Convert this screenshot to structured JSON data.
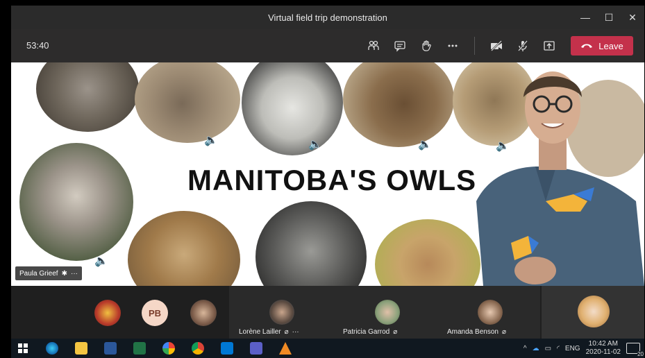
{
  "window": {
    "title": "Virtual field trip demonstration",
    "controls": [
      "—",
      "☐",
      "✕"
    ]
  },
  "toolbar": {
    "timer": "53:40",
    "leave_label": "Leave"
  },
  "slide": {
    "title": "MANITOBA'S OWLS"
  },
  "presenter": {
    "name": "Paula Grieef"
  },
  "participants": [
    {
      "initials": "PB"
    },
    {
      "name": "Lorène Lailler"
    },
    {
      "name": "Patricia Garrod"
    },
    {
      "name": "Amanda Benson"
    }
  ],
  "taskbar": {
    "language": "ENG",
    "time": "10:42 AM",
    "date": "2020-11-02",
    "notifications": "20"
  },
  "colors": {
    "leave": "#c4314b",
    "toolbar": "#2d2c2c",
    "titlebar": "#2b2b2b"
  }
}
